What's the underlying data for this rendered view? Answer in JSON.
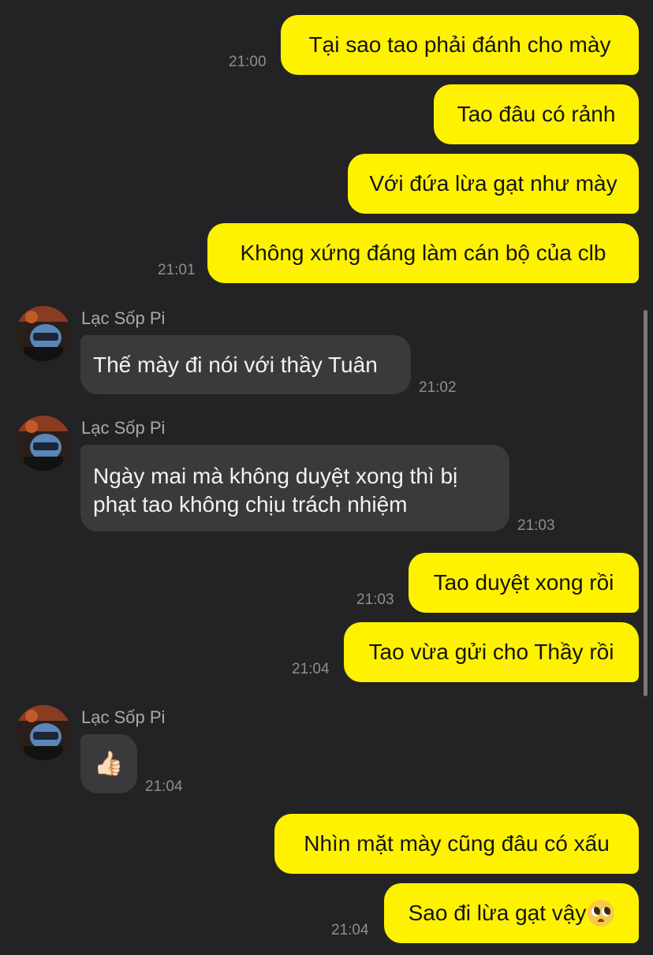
{
  "contact": {
    "name": "Lạc Sốp Pi"
  },
  "messages": [
    {
      "dir": "out",
      "text": "Tại sao tao phải đánh cho mày",
      "time": "21:00"
    },
    {
      "dir": "out",
      "text": "Tao đâu có rảnh",
      "time": ""
    },
    {
      "dir": "out",
      "text": "Với đứa lừa gạt như mày",
      "time": ""
    },
    {
      "dir": "out",
      "text": "Không xứng đáng làm cán bộ của clb",
      "time": "21:01"
    },
    {
      "dir": "in",
      "text": "Thế mày đi nói với thầy Tuân",
      "time": "21:02"
    },
    {
      "dir": "in",
      "text": "Ngày mai mà không duyệt xong thì bị phạt tao không chịu trách nhiệm",
      "time": "21:03"
    },
    {
      "dir": "out",
      "text": "Tao duyệt xong rồi",
      "time": "21:03"
    },
    {
      "dir": "out",
      "text": "Tao vừa gửi cho Thầy rồi",
      "time": "21:04"
    },
    {
      "dir": "in",
      "sticker": "thumbs-up",
      "text": "👍🏻",
      "time": "21:04"
    },
    {
      "dir": "out",
      "text": "Nhìn mặt mày cũng đâu có xấu",
      "time": ""
    },
    {
      "dir": "out",
      "text": "Sao đi lừa gạt vậy",
      "emoji": "pleading-face",
      "time": "21:04"
    }
  ],
  "colors": {
    "outgoing": "#FFF200",
    "incoming": "#3A3A3C",
    "background": "#232325"
  }
}
